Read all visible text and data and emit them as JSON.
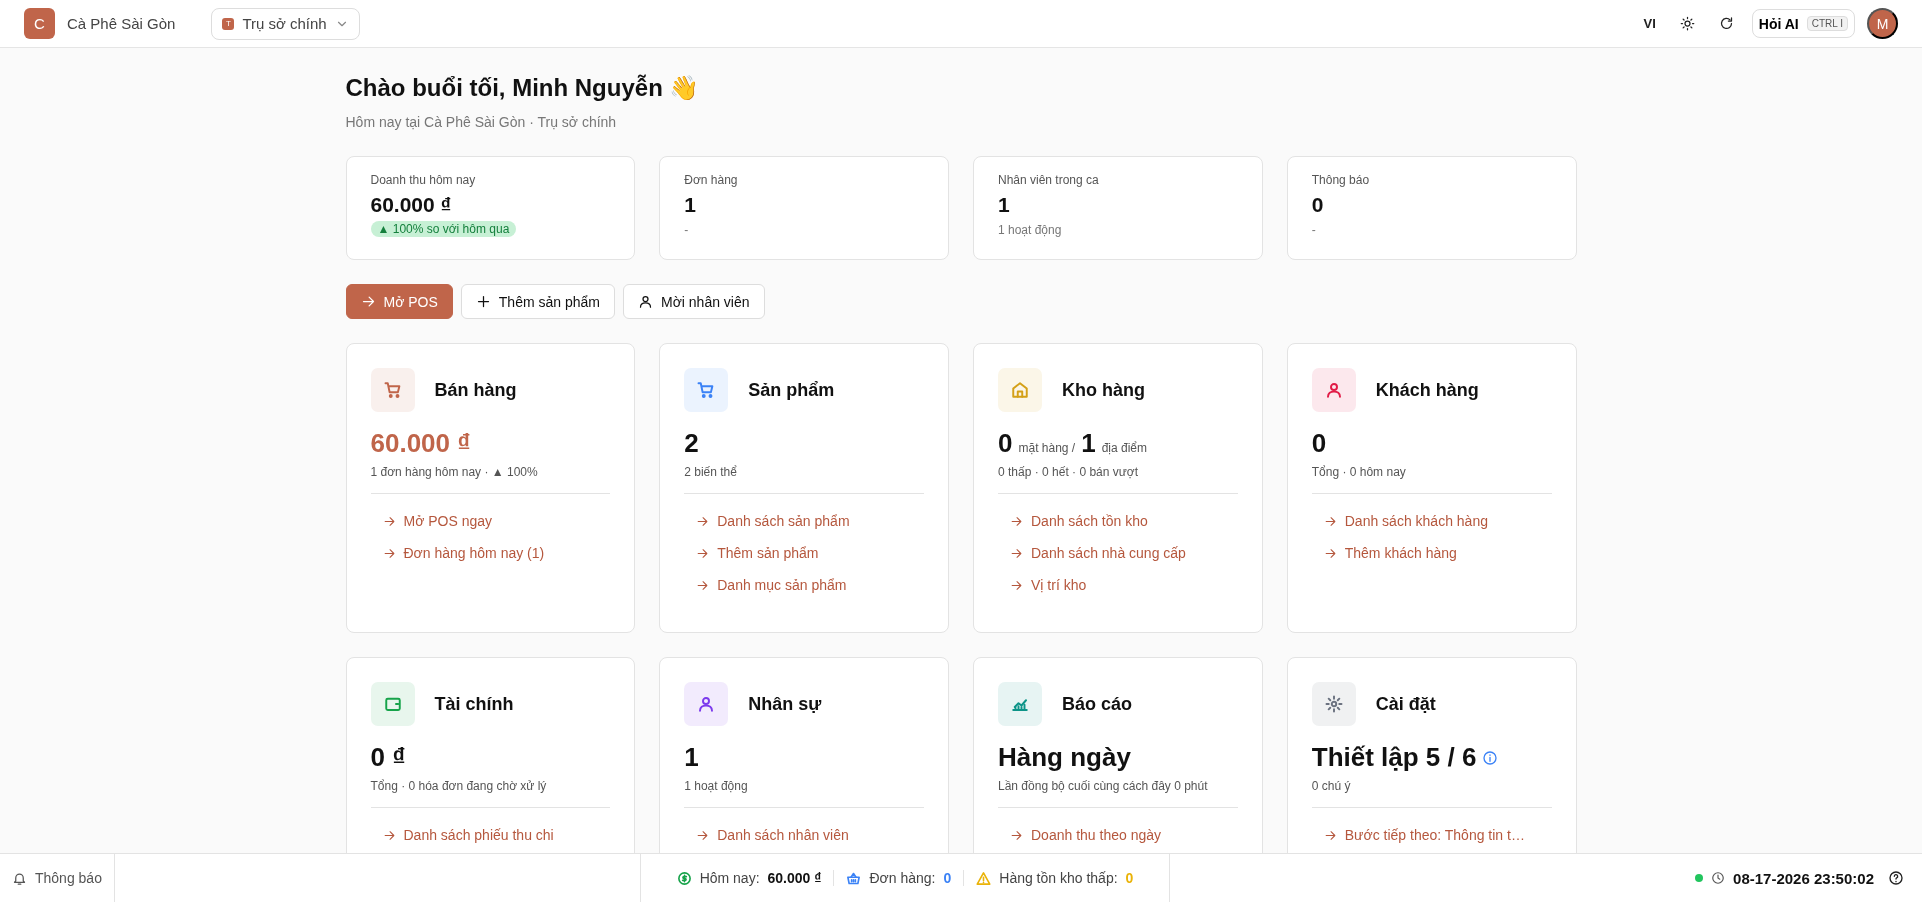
{
  "topbar": {
    "logo_letter": "C",
    "brand": "Cà Phê Sài Gòn",
    "branch": {
      "badge": "T",
      "name": "Trụ sở chính"
    },
    "language": "VI",
    "ask_ai": {
      "label": "Hỏi AI",
      "shortcut": "CTRL I"
    },
    "avatar": "M"
  },
  "greeting": {
    "title": "Chào buổi tối, Minh Nguyễn 👋",
    "subtitle": "Hôm nay tại Cà Phê Sài Gòn · Trụ sở chính"
  },
  "stats": [
    {
      "label": "Doanh thu hôm nay",
      "value": "60.000 ₫",
      "badge": "▲ 100% so với hôm qua"
    },
    {
      "label": "Đơn hàng",
      "value": "1",
      "note": "-"
    },
    {
      "label": "Nhân viên trong ca",
      "value": "1",
      "note": "1 hoạt động"
    },
    {
      "label": "Thông báo",
      "value": "0",
      "note": "-"
    }
  ],
  "actions": [
    {
      "kind": "primary",
      "label": "Mở POS"
    },
    {
      "kind": "secondary",
      "label": "Thêm sản phẩm"
    },
    {
      "kind": "secondary",
      "label": "Mời nhân viên"
    }
  ],
  "modules": [
    {
      "kind": "cart",
      "color": "#c0654a",
      "title": "Bán hàng",
      "accent": true,
      "value": [
        {
          "text": "60.000 ₫",
          "kind": "big"
        }
      ],
      "note": "1 đơn hàng hôm nay · ▲ 100%",
      "links": [
        "Mở POS ngay",
        "Đơn hàng hôm nay (1)"
      ]
    },
    {
      "kind": "cart",
      "color": "#3b82f6",
      "title": "Sản phẩm",
      "accent": false,
      "value": [
        {
          "text": "2",
          "kind": "big"
        }
      ],
      "note": "2 biến thể",
      "links": [
        "Danh sách sản phẩm",
        "Thêm sản phẩm",
        "Danh mục sản phẩm"
      ]
    },
    {
      "kind": "home",
      "color": "#d4a017",
      "title": "Kho hàng",
      "accent": false,
      "value": [
        {
          "text": "0",
          "kind": "big"
        },
        {
          "text": "mặt hàng /",
          "kind": "small"
        },
        {
          "text": "1",
          "kind": "big"
        },
        {
          "text": "địa điểm",
          "kind": "small"
        }
      ],
      "note": "0 thấp · 0 hết · 0 bán vượt",
      "links": [
        "Danh sách tồn kho",
        "Danh sách nhà cung cấp",
        "Vị trí kho"
      ]
    },
    {
      "kind": "user",
      "color": "#e11d48",
      "title": "Khách hàng",
      "accent": false,
      "value": [
        {
          "text": "0",
          "kind": "big"
        }
      ],
      "note": "Tổng · 0 hôm nay",
      "links": [
        "Danh sách khách hàng",
        "Thêm khách hàng"
      ]
    },
    {
      "kind": "wallet",
      "color": "#16a34a",
      "title": "Tài chính",
      "accent": false,
      "value": [
        {
          "text": "0 ₫",
          "kind": "big"
        }
      ],
      "note": "Tổng · 0 hóa đơn đang chờ xử lý",
      "links": [
        "Danh sách phiếu thu chi"
      ]
    },
    {
      "kind": "user",
      "color": "#7c3aed",
      "title": "Nhân sự",
      "accent": false,
      "value": [
        {
          "text": "1",
          "kind": "big"
        }
      ],
      "note": "1 hoạt động",
      "links": [
        "Danh sách nhân viên"
      ]
    },
    {
      "kind": "chart",
      "color": "#0d9488",
      "title": "Báo cáo",
      "accent": false,
      "value": [
        {
          "text": "Hàng ngày",
          "kind": "big"
        }
      ],
      "note": "Lần đồng bộ cuối cùng cách đây 0 phút",
      "links": [
        "Doanh thu theo ngày"
      ]
    },
    {
      "kind": "gear",
      "color": "#6b7280",
      "title": "Cài đặt",
      "accent": false,
      "info": true,
      "value": [
        {
          "text": "Thiết lập 5 / 6",
          "kind": "big"
        }
      ],
      "note": "0 chú ý",
      "links": [
        "Bước tiếp theo: Thông tin t…"
      ]
    }
  ],
  "status_bar": {
    "notifications": "Thông báo",
    "items": [
      {
        "kind": "dollar",
        "color": "#16a34a",
        "label": "Hôm nay:",
        "value": "60.000 ₫"
      },
      {
        "kind": "basket",
        "color": "#3b82f6",
        "label": "Đơn hàng:",
        "value": "0"
      },
      {
        "kind": "warning",
        "color": "#eab308",
        "label": "Hàng tồn kho thấp:",
        "value": "0"
      }
    ],
    "online": true,
    "datetime": "08-17-2026 23:50:02"
  }
}
